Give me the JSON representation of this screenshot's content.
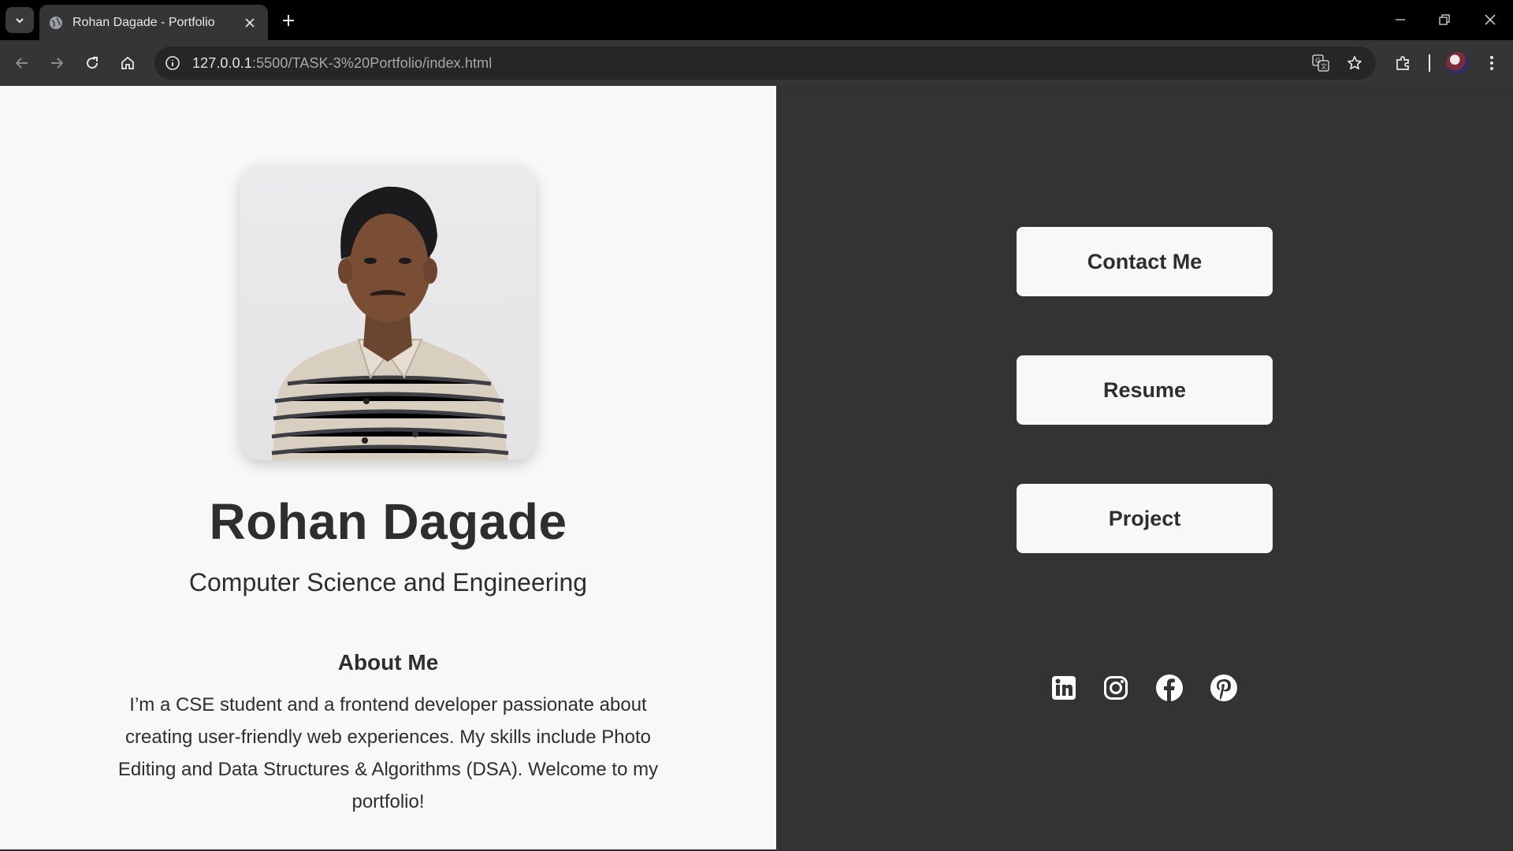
{
  "browser": {
    "tab_title": "Rohan Dagade - Portfolio",
    "url_host": "127.0.0.1",
    "url_rest": ":5500/TASK-3%20Portfolio/index.html"
  },
  "profile": {
    "name": "Rohan Dagade",
    "subtitle": "Computer Science and Engineering",
    "about_title": "About Me",
    "about_text": "I’m a CSE student and a frontend developer passionate about creating user-friendly web experiences. My skills include Photo Editing and Data Structures & Algorithms (DSA). Welcome to my portfolio!"
  },
  "buttons": {
    "contact": "Contact Me",
    "resume": "Resume",
    "project": "Project"
  },
  "social_icons": [
    "linkedin-icon",
    "instagram-icon",
    "facebook-icon",
    "pinterest-icon"
  ],
  "colors": {
    "left_bg": "#f8f8f8",
    "right_bg": "#333333",
    "text": "#2e2e2e",
    "button_bg": "#f8f8f8"
  }
}
